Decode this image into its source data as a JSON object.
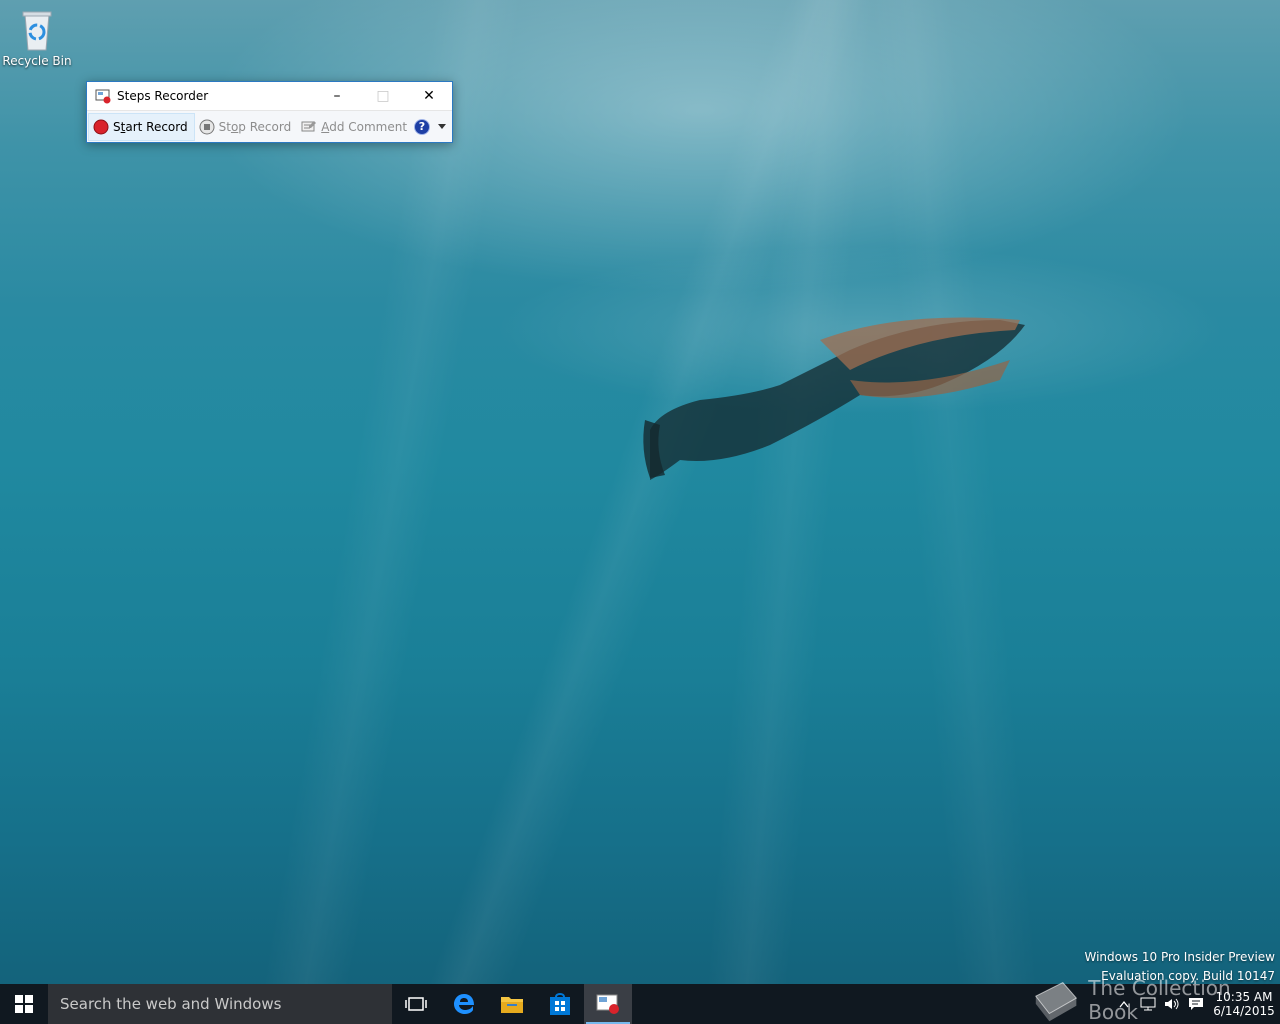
{
  "desktop": {
    "recycle_bin_label": "Recycle Bin"
  },
  "window": {
    "title": "Steps Recorder",
    "buttons": {
      "minimize": "–",
      "maximize": "□",
      "close": "✕"
    },
    "toolbar": {
      "start_record": {
        "pre": "S",
        "accel": "t",
        "post": "art Record"
      },
      "stop_record": {
        "pre": "St",
        "accel": "o",
        "post": "p Record"
      },
      "add_comment": {
        "pre": "",
        "accel": "A",
        "post": "dd Comment"
      },
      "help": "?"
    }
  },
  "watermark": {
    "line1": "Windows 10 Pro Insider Preview",
    "line2": "Evaluation copy. Build 10147"
  },
  "brand": {
    "text": "The Collection Book"
  },
  "taskbar": {
    "search_placeholder": "Search the web and Windows",
    "apps": [
      "task-view",
      "edge",
      "file-explorer",
      "store",
      "steps-recorder"
    ],
    "clock_time": "10:35 AM",
    "clock_date": "6/14/2015"
  },
  "colors": {
    "accent": "#76b9ed",
    "window_border": "#2b79c2",
    "record_red": "#d9232b"
  }
}
